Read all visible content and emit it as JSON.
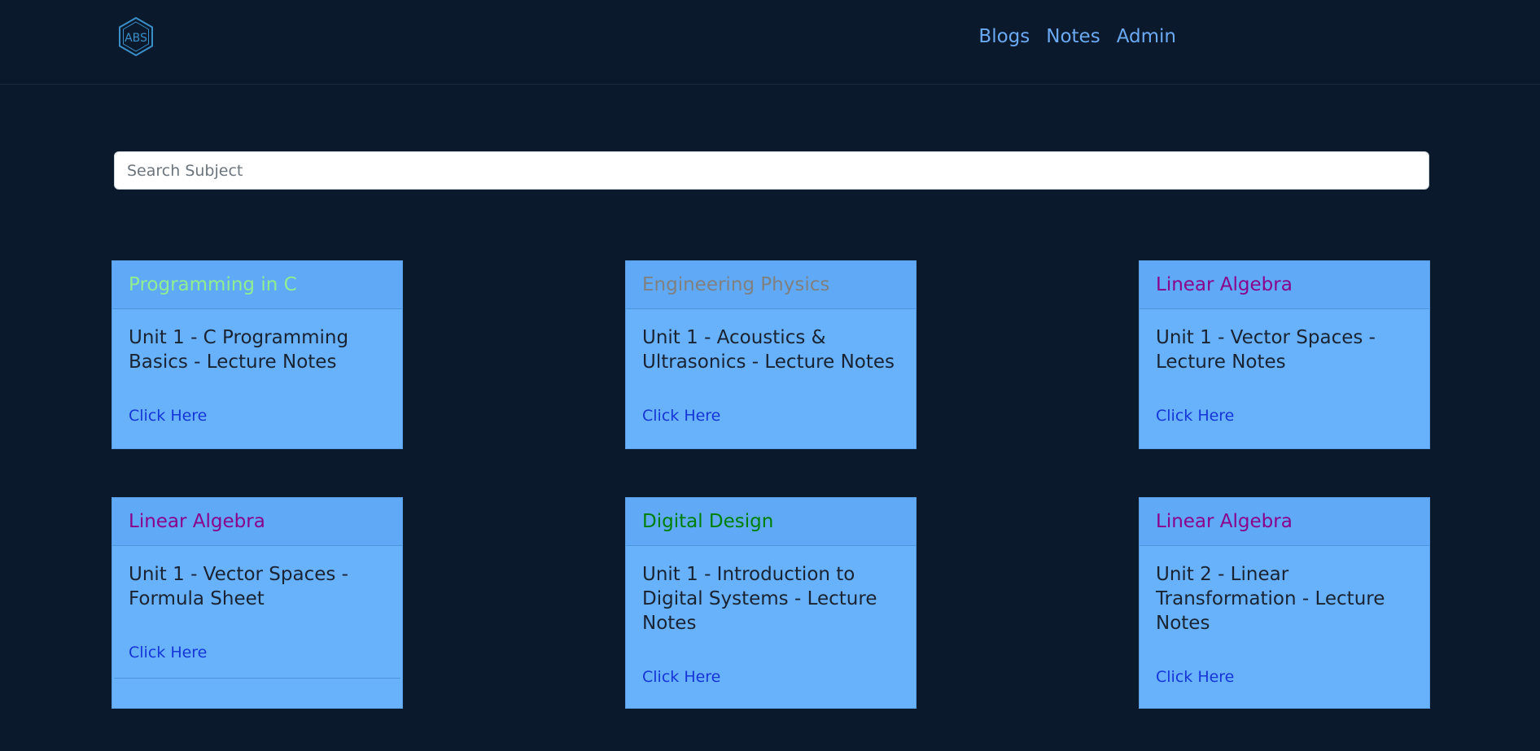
{
  "nav": {
    "logo_text": "ABS",
    "links": [
      "Blogs",
      "Notes",
      "Admin"
    ]
  },
  "search": {
    "placeholder": "Search Subject",
    "value": ""
  },
  "cards": [
    {
      "title": "Programming in C",
      "title_color": "#90ee90",
      "text": "Unit 1 - C Programming Basics - Lecture Notes",
      "link": "Click Here"
    },
    {
      "title": "Engineering Physics",
      "title_color": "#808080",
      "text": "Unit 1 - Acoustics & Ultrasonics - Lecture Notes",
      "link": "Click Here"
    },
    {
      "title": "Linear Algebra",
      "title_color": "#8b008b",
      "text": "Unit 1 - Vector Spaces - Lecture Notes",
      "link": "Click Here"
    },
    {
      "title": "Linear Algebra",
      "title_color": "#8b008b",
      "text": "Unit 1 - Vector Spaces - Formula Sheet",
      "link": "Click Here"
    },
    {
      "title": "Digital Design",
      "title_color": "#008000",
      "text": "Unit 1 - Introduction to Digital Systems - Lecture Notes",
      "link": "Click Here"
    },
    {
      "title": "Linear Algebra",
      "title_color": "#8b008b",
      "text": "Unit 2 - Linear Transformation - Lecture Notes",
      "link": "Click Here"
    }
  ],
  "colors": {
    "background": "#0b192c",
    "nav_link": "#6aaaf4",
    "card_bg": "#68b1fb",
    "card_link": "#1436d8"
  }
}
